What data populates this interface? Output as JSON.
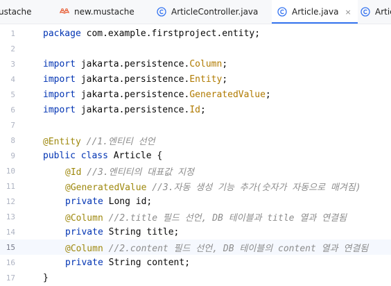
{
  "tabs": [
    {
      "label": "ustache",
      "icon": "mustache-file-icon",
      "active": false
    },
    {
      "label": "new.mustache",
      "icon": "mustache-file-icon",
      "active": false
    },
    {
      "label": "ArticleController.java",
      "icon": "java-class-icon",
      "active": false
    },
    {
      "label": "Article.java",
      "icon": "java-class-icon",
      "active": true,
      "close": "×"
    },
    {
      "label": "Artic",
      "icon": "java-class-icon",
      "active": false
    }
  ],
  "colors": {
    "keyword": "#0033b3",
    "annotation": "#9e880d",
    "imported_class": "#b07a00",
    "comment": "#8c8c8c",
    "accent": "#3574f0",
    "mustache_icon": "#e8613a",
    "class_icon": "#3574f0"
  },
  "current_line": 15,
  "lines": [
    {
      "num": "1",
      "kw": "package",
      "rest": " com.example.firstproject.entity;"
    },
    {
      "num": "2"
    },
    {
      "num": "3",
      "kw": "import",
      "pkg": " jakarta.persistence.",
      "cls": "Column",
      "end": ";"
    },
    {
      "num": "4",
      "kw": "import",
      "pkg": " jakarta.persistence.",
      "cls": "Entity",
      "end": ";"
    },
    {
      "num": "5",
      "kw": "import",
      "pkg": " jakarta.persistence.",
      "cls": "GeneratedValue",
      "end": ";"
    },
    {
      "num": "6",
      "kw": "import",
      "pkg": " jakarta.persistence.",
      "cls": "Id",
      "end": ";"
    },
    {
      "num": "7"
    },
    {
      "num": "8",
      "ann": "@Entity",
      "comment": " //1.엔티티 선언"
    },
    {
      "num": "9",
      "kw": "public class",
      "rest": " Article {"
    },
    {
      "num": "10",
      "ann": "@Id",
      "comment": " //3.엔티티의 대표값 지정"
    },
    {
      "num": "11",
      "ann": "@GeneratedValue",
      "comment": " //3.자동 생성 기능 추가(숫자가 자동으로 매겨짐)"
    },
    {
      "num": "12",
      "kw": "private",
      "rest": " Long id;"
    },
    {
      "num": "13",
      "ann": "@Column",
      "comment": " //2.title 필드 선언, DB 테이블과 title 열과 연결됨"
    },
    {
      "num": "14",
      "kw": "private",
      "rest": " String title;"
    },
    {
      "num": "15",
      "ann": "@Column",
      "comment": " //2.content 필드 선언, DB 테이블의 content 열과 연결됨"
    },
    {
      "num": "16",
      "kw": "private",
      "rest": " String content;"
    },
    {
      "num": "17",
      "rest": "}"
    }
  ]
}
